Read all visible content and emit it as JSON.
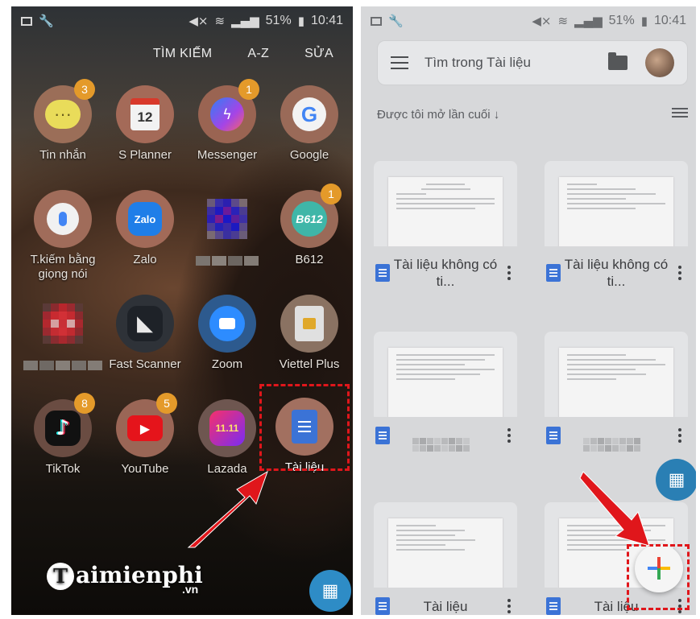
{
  "left": {
    "status": {
      "battery": "51%",
      "time": "10:41"
    },
    "topbar": {
      "search": "TÌM KIẾM",
      "sort": "A-Z",
      "edit": "SỬA"
    },
    "apps": [
      {
        "name": "Tin nhắn",
        "icon": "messages-icon",
        "badge": "3"
      },
      {
        "name": "S Planner",
        "icon": "calendar-icon",
        "badge": "",
        "date": "12"
      },
      {
        "name": "Messenger",
        "icon": "messenger-icon",
        "badge": "1"
      },
      {
        "name": "Google",
        "icon": "google-icon",
        "badge": ""
      },
      {
        "name": "T.kiếm bằng giọng nói",
        "icon": "voice-search-icon",
        "badge": ""
      },
      {
        "name": "Zalo",
        "icon": "zalo-icon",
        "badge": "",
        "label": "Zalo"
      },
      {
        "name": "",
        "icon": "pixelated-app-icon",
        "badge": ""
      },
      {
        "name": "B612",
        "icon": "b612-icon",
        "badge": "1",
        "label": "B612"
      },
      {
        "name": "",
        "icon": "pixelated-app-icon",
        "badge": ""
      },
      {
        "name": "Fast Scanner",
        "icon": "scanner-icon",
        "badge": ""
      },
      {
        "name": "Zoom",
        "icon": "zoom-icon",
        "badge": ""
      },
      {
        "name": "Viettel Plus",
        "icon": "sim-card-icon",
        "badge": ""
      },
      {
        "name": "TikTok",
        "icon": "tiktok-icon",
        "badge": "8"
      },
      {
        "name": "YouTube",
        "icon": "youtube-icon",
        "badge": "5"
      },
      {
        "name": "Lazada",
        "icon": "lazada-icon",
        "badge": "",
        "label": "11.11"
      },
      {
        "name": "Tài liệu",
        "icon": "docs-icon",
        "badge": ""
      }
    ],
    "watermark": {
      "brand": "aimienphi",
      "suffix": ".vn"
    }
  },
  "right": {
    "status": {
      "battery": "51%",
      "time": "10:41"
    },
    "search": {
      "placeholder": "Tìm trong Tài liệu"
    },
    "sort_label": "Được tôi mở lần cuối ↓",
    "documents": [
      {
        "title": "Tài liệu không có ti..."
      },
      {
        "title": "Tài liệu không có ti..."
      },
      {
        "title": ""
      },
      {
        "title": ""
      },
      {
        "title": "Tài liệu"
      },
      {
        "title": "Tài liệu"
      }
    ]
  },
  "colors": {
    "highlight": "#e0161b",
    "docs_blue": "#3b73d6",
    "badge": "#e49a2a",
    "fab": "#2e8cc6"
  }
}
